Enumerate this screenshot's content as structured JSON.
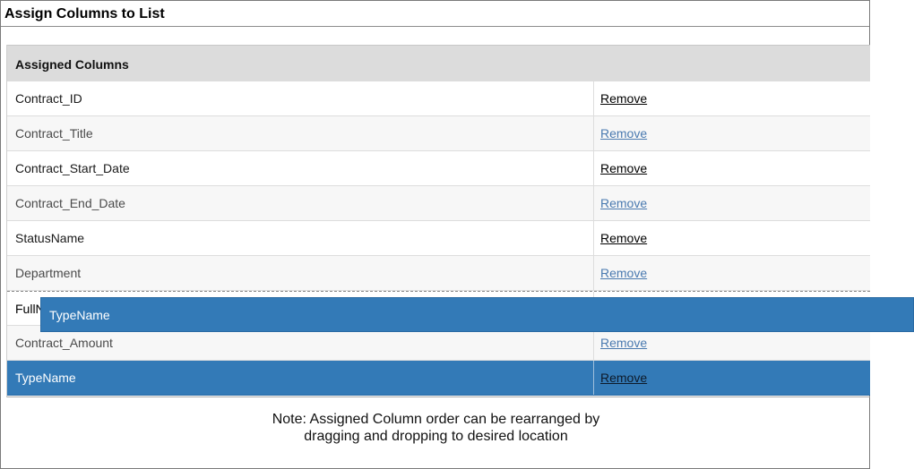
{
  "title": "Assign Columns to List",
  "panel": {
    "header": "Assigned Columns",
    "remove_label": "Remove",
    "rows": [
      {
        "name": "Contract_ID"
      },
      {
        "name": "Contract_Title"
      },
      {
        "name": "Contract_Start_Date"
      },
      {
        "name": "Contract_End_Date"
      },
      {
        "name": "StatusName"
      },
      {
        "name": "Department"
      },
      {
        "name": "FullName"
      },
      {
        "name": "Contract_Amount"
      },
      {
        "name": "TypeName"
      }
    ]
  },
  "drag_ghost": {
    "label": "TypeName"
  },
  "note": {
    "line1": "Note: Assigned Column order can be rearranged by",
    "line2": "dragging and dropping to desired location"
  },
  "colors": {
    "selected": "#337ab7",
    "header_bg": "#dcdcdc",
    "link_alt": "#4a7ab0"
  }
}
